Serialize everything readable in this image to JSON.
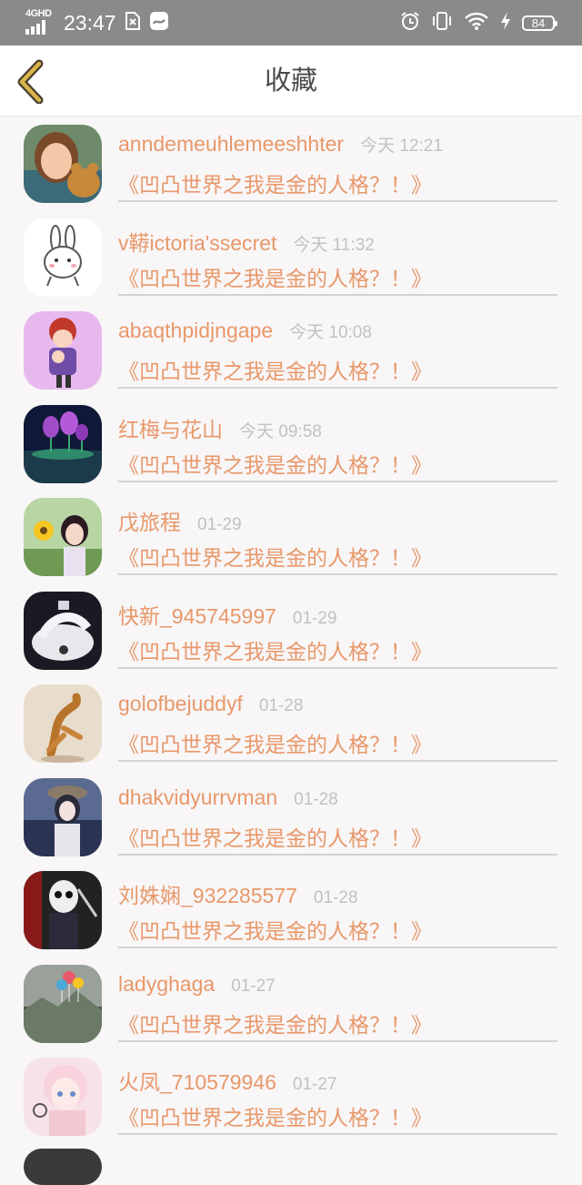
{
  "status_bar": {
    "network": "4GHD",
    "time": "23:47",
    "battery": "84",
    "icons": [
      "sim-icon",
      "notification-app-icon",
      "alarm-icon",
      "vibrate-icon",
      "wifi-icon",
      "charging-icon",
      "battery-icon"
    ]
  },
  "nav": {
    "title": "收藏",
    "back_icon": "chevron-left-icon",
    "accent": "#d9b54a"
  },
  "colors": {
    "accent_text": "#e8986a",
    "time_text": "#c2c0c1",
    "background": "#f8f6f7"
  },
  "items": [
    {
      "user": "anndemeuhlemeeshhter",
      "time": "今天 12:21",
      "title": "《凹凸世界之我是金的人格？！》",
      "avatar": "child-with-teddy-bear"
    },
    {
      "user": "v鞯ictoria'ssecret",
      "time": "今天 11:32",
      "title": "《凹凸世界之我是金的人格？！》",
      "avatar": "white-rabbit-cartoon"
    },
    {
      "user": "abaqthpidjngape",
      "time": "今天 10:08",
      "title": "《凹凸世界之我是金的人格？！》",
      "avatar": "anime-boy-holding-baby"
    },
    {
      "user": "红梅与花山",
      "time": "今天 09:58",
      "title": "《凹凸世界之我是金的人格？！》",
      "avatar": "purple-lotus-night"
    },
    {
      "user": "戊旅程",
      "time": "01-29",
      "title": "《凹凸世界之我是金的人格？！》",
      "avatar": "girl-with-sunflower"
    },
    {
      "user": "快新_945745997",
      "time": "01-29",
      "title": "《凹凸世界之我是金的人格？！》",
      "avatar": "white-horse-rider"
    },
    {
      "user": "golofbejuddyf",
      "time": "01-28",
      "title": "《凹凸世界之我是金的人格？！》",
      "avatar": "dancing-figure"
    },
    {
      "user": "dhakvidyurrvman",
      "time": "01-28",
      "title": "《凹凸世界之我是金的人格？！》",
      "avatar": "anime-girl-hat"
    },
    {
      "user": "刘姝娴_932285577",
      "time": "01-28",
      "title": "《凹凸世界之我是金的人格？！》",
      "avatar": "skull-character"
    },
    {
      "user": "ladyghaga",
      "time": "01-27",
      "title": "《凹凸世界之我是金的人格？！》",
      "avatar": "balloons-landscape"
    },
    {
      "user": "火凤_710579946",
      "time": "01-27",
      "title": "《凹凸世界之我是金的人格？！》",
      "avatar": "anime-girl-pastel"
    }
  ]
}
